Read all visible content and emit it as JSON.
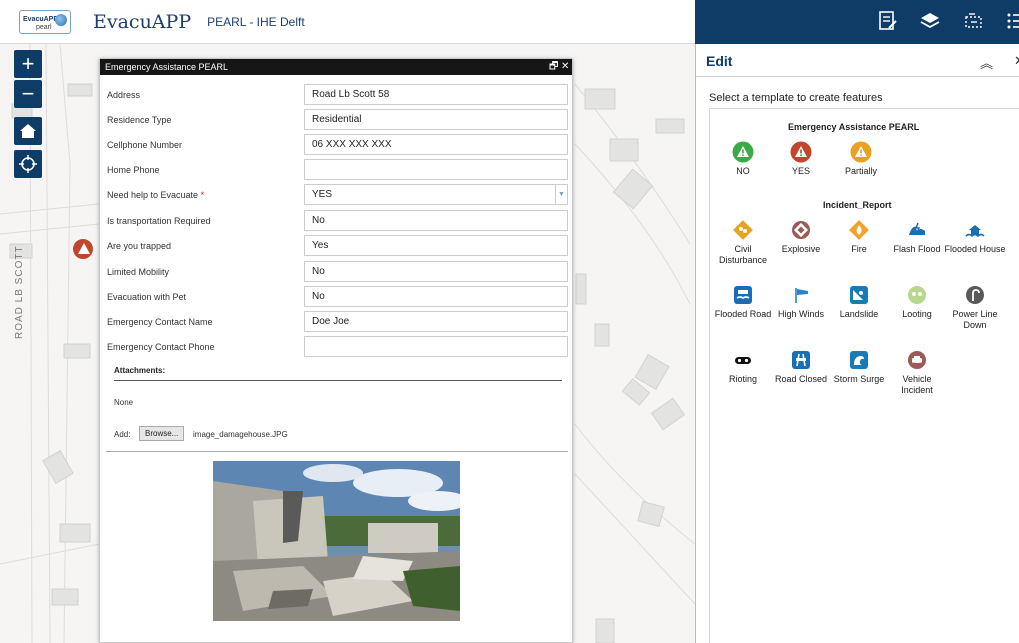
{
  "header": {
    "logo": {
      "name": "EvacuAPP",
      "sub": "pearl"
    },
    "title": "EvacuAPP",
    "subtitle": "PEARL - IHE Delft"
  },
  "toolbar": {
    "icons": [
      "edit-icon",
      "layers-icon",
      "select-icon",
      "list-icon"
    ]
  },
  "map": {
    "road_label": "ROAD LB SCOTT",
    "zoom_in": "+",
    "zoom_out": "−"
  },
  "popup": {
    "title": "Emergency Assistance PEARL",
    "fields": [
      {
        "label": "Address",
        "value": "Road Lb Scott 58"
      },
      {
        "label": "Residence Type",
        "value": "Residential"
      },
      {
        "label": "Cellphone Number",
        "value": "06 XXX XXX XXX"
      },
      {
        "label": "Home Phone",
        "value": ""
      },
      {
        "label": "Need help to Evacuate",
        "required": "*",
        "value": "YES"
      },
      {
        "label": "Is transportation Required",
        "value": "No"
      },
      {
        "label": "Are you trapped",
        "value": "Yes"
      },
      {
        "label": "Limited Mobility",
        "value": "No"
      },
      {
        "label": "Evacuation with Pet",
        "value": "No"
      },
      {
        "label": "Emergency Contact Name",
        "value": "Doe Joe"
      },
      {
        "label": "Emergency Contact Phone",
        "value": ""
      }
    ],
    "attachments": {
      "title": "Attachments:",
      "none": "None",
      "add_label": "Add:",
      "browse": "Browse...",
      "file": "image_damagehouse.JPG"
    }
  },
  "panel": {
    "title": "Edit",
    "hint": "Select a template to create features",
    "groups": [
      {
        "title": "Emergency Assistance PEARL",
        "items": [
          {
            "label": "NO",
            "icon": "warning-green-icon",
            "color": "#3aaa4a"
          },
          {
            "label": "YES",
            "icon": "warning-red-icon",
            "color": "#c2452d"
          },
          {
            "label": "Partially",
            "icon": "warning-orange-icon",
            "color": "#e9a21f"
          }
        ]
      },
      {
        "title": "Incident_Report",
        "items": [
          {
            "label": "Civil Disturbance",
            "icon": "civil-disturbance-icon",
            "color": "#e6a321"
          },
          {
            "label": "Explosive",
            "icon": "explosive-icon",
            "color": "#9a5b56"
          },
          {
            "label": "Fire",
            "icon": "fire-icon",
            "color": "#f2a12a"
          },
          {
            "label": "Flash Flood",
            "icon": "flash-flood-icon",
            "color": "#1a6fb4"
          },
          {
            "label": "Flooded House",
            "icon": "flooded-house-icon",
            "color": "#1a6fb4"
          },
          {
            "label": "Flooded Road",
            "icon": "flooded-road-icon",
            "color": "#1a6fb4"
          },
          {
            "label": "High Winds",
            "icon": "high-winds-icon",
            "color": "#2a82cf"
          },
          {
            "label": "Landslide",
            "icon": "landslide-icon",
            "color": "#1a7ab4"
          },
          {
            "label": "Looting",
            "icon": "looting-icon",
            "color": "#b7d88c"
          },
          {
            "label": "Power Line Down",
            "icon": "power-line-down-icon",
            "color": "#5a5a5a"
          },
          {
            "label": "Rioting",
            "icon": "rioting-icon",
            "color": "#111111"
          },
          {
            "label": "Road Closed",
            "icon": "road-closed-icon",
            "color": "#1a6fb4"
          },
          {
            "label": "Storm Surge",
            "icon": "storm-surge-icon",
            "color": "#1a7ab4"
          },
          {
            "label": "Vehicle Incident",
            "icon": "vehicle-incident-icon",
            "color": "#9a5b56"
          }
        ]
      }
    ]
  }
}
